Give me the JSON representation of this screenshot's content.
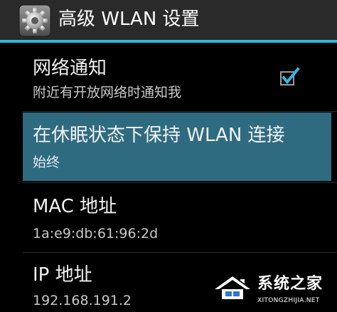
{
  "action_bar": {
    "icon": "settings-gear-icon",
    "title": "高级 WLAN 设置",
    "accent_color": "#33b5e5"
  },
  "preferences": [
    {
      "key": "network_notification",
      "title": "网络通知",
      "summary": "附近有开放网络时通知我",
      "checked": true
    },
    {
      "key": "keep_wifi_during_sleep",
      "title": "在休眠状态下保持 WLAN 连接",
      "summary": "始终",
      "highlighted": true
    },
    {
      "key": "mac_address",
      "title": "MAC 地址",
      "summary": "1a:e9:db:61:96:2d"
    },
    {
      "key": "ip_address",
      "title": "IP 地址",
      "summary": "192.168.191.2"
    }
  ],
  "watermark": {
    "icon": "system-house-logo-icon",
    "name": "系统之家",
    "url": "XITONGZHIJIA.NET"
  },
  "colors": {
    "background": "#000000",
    "action_bar": "#2a2a2a",
    "highlight": "#2f6b80",
    "checkbox_check": "#33b5e5"
  }
}
